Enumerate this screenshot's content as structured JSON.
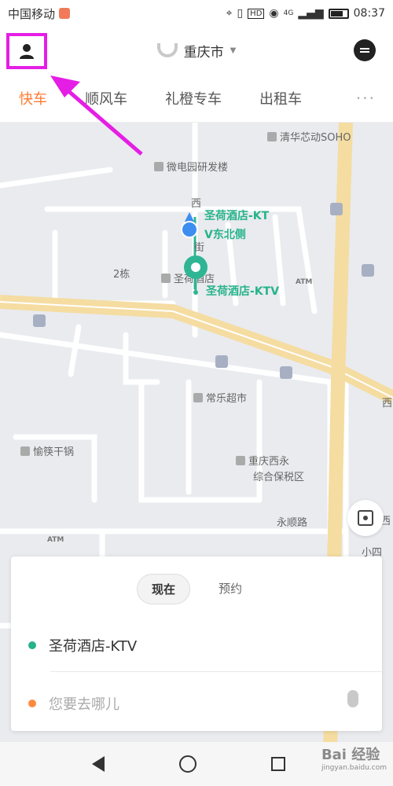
{
  "status": {
    "carrier": "中国移动",
    "network": "4G",
    "hd": "HD",
    "time": "08:37"
  },
  "header": {
    "city": "重庆市"
  },
  "tabs": [
    {
      "label": "快车"
    },
    {
      "label": "顺风车"
    },
    {
      "label": "礼橙专车"
    },
    {
      "label": "出租车"
    }
  ],
  "tabs_more": "···",
  "map": {
    "pois": {
      "tsinghua": "清华芯动SOHO",
      "weidian": "微电园研发楼",
      "xi": "西",
      "jie": "街",
      "pickup_line1": "圣荷酒店-KT",
      "pickup_line2": "V东北侧",
      "building2": "2栋",
      "hotel": "圣荷酒店",
      "selected": "圣荷酒店-KTV",
      "changle": "常乐超市",
      "yuxiao": "愉筷干锅",
      "bonded1": "重庆西永",
      "bonded2": "综合保税区",
      "yongshun": "永顺路",
      "xi_right": "西",
      "xi_road": "西",
      "xiao": "小四",
      "xi_bottom": "西"
    },
    "atm": "ATM"
  },
  "card": {
    "time_options": [
      {
        "label": "现在"
      },
      {
        "label": "预约"
      }
    ],
    "start": "圣荷酒店-KTV",
    "destination_placeholder": "您要去哪儿",
    "start_color": "#26b38a",
    "dest_color": "#ff8a3d"
  },
  "watermark": {
    "brand": "Bai 经验",
    "url": "jingyan.baidu.com"
  },
  "colors": {
    "accent": "#ff7a30",
    "annotation": "#e51ee5",
    "pin": "#2fb594"
  }
}
